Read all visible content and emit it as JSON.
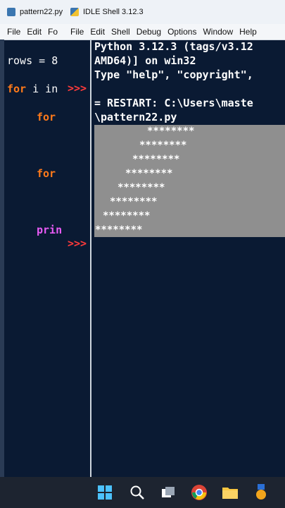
{
  "editor": {
    "title": "pattern22.py",
    "menu": [
      "File",
      "Edit",
      "Fo"
    ],
    "lines": {
      "l1": "rows = 8",
      "l2_kw": "for",
      "l2_rest": " i in",
      "l3_kw": "for",
      "l4_kw": "for",
      "l5": "prin"
    }
  },
  "shell": {
    "title": "IDLE Shell 3.12.3",
    "menu": [
      "File",
      "Edit",
      "Shell",
      "Debug",
      "Options",
      "Window",
      "Help"
    ],
    "lines": [
      "Python 3.12.3 (tags/v3.12",
      "AMD64)] on win32",
      "Type \"help\", \"copyright\",",
      "",
      "= RESTART: C:\\Users\\maste",
      "\\pattern22.py"
    ],
    "pattern": [
      "********",
      "********",
      "********",
      "********",
      "********",
      "********",
      "********",
      "********"
    ],
    "prompt": ">>>"
  },
  "taskbar": {
    "icons": [
      "windows-start-icon",
      "search-icon",
      "task-view-icon",
      "chrome-icon",
      "file-explorer-icon",
      "app-icon"
    ]
  },
  "colors": {
    "background": "#0a1a33",
    "keyword": "#ff7a1a",
    "builtin": "#e85bf5",
    "prompt": "#ff3b3b",
    "selection": "#8f8f8f"
  }
}
